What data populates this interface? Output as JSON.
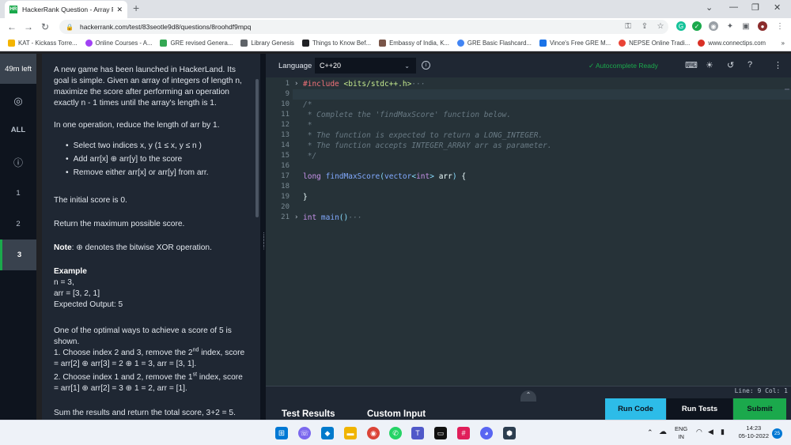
{
  "browser": {
    "tab_title": "HackerRank Question - Array Re...",
    "tab_favicon": "HR",
    "url": "hackerrank.com/test/83seotle9d8/questions/8roohdf9mpq",
    "bookmarks": [
      "KAT - Kickass Torre...",
      "Online Courses - A...",
      "GRE revised Genera...",
      "Library Genesis",
      "Things to Know Bef...",
      "Embassy of India, K...",
      "GRE Basic Flashcard...",
      "Vince's Free GRE M...",
      "NEPSE Online Tradi...",
      "www.connectips.com"
    ],
    "bookmark_colors": [
      "#f4b400",
      "#a142f4",
      "#34a853",
      "#5f6368",
      "#202124",
      "#795548",
      "#4285f4",
      "#1a73e8",
      "#ea4335",
      "#d93025"
    ]
  },
  "sidenav": {
    "timer": "49m left",
    "all_label": "ALL",
    "questions": [
      "1",
      "2",
      "3"
    ]
  },
  "problem": {
    "p1": "A new game has been launched in HackerLand. Its goal is simple. Given an array of integers of length n, maximize the score after performing an operation exactly n - 1 times until the array's length is 1.",
    "p2": "In one operation, reduce the length of arr by 1.",
    "bullets": [
      "Select two indices x, y (1 ≤ x, y ≤ n )",
      "Add arr[x] ⊕ arr[y] to the score",
      "Remove either arr[x] or arr[y] from arr."
    ],
    "p3": "The initial score is 0.",
    "p4": "Return the maximum possible score.",
    "note_label": "Note",
    "note_text": ": ⊕ denotes the bitwise XOR operation.",
    "example_title": "Example",
    "ex_n": "n = 3,",
    "ex_arr": "arr = [3, 2, 1]",
    "ex_out": "Expected Output: 5",
    "p5": "One of the optimal ways to achieve a score of 5 is shown.",
    "step1": "1. Choose index 2 and 3, remove the 2",
    "step1_sup": "nd",
    "step1_rest": " index, score = arr[2] ⊕ arr[3] = 2 ⊕ 1 = 3, arr = [3, 1].",
    "step2": "2. Choose index 1 and 2, remove the 1",
    "step2_sup": "st",
    "step2_rest": " index, score = arr[1] ⊕ arr[2] = 3 ⊕ 1 = 2, arr = [1].",
    "p6": "Sum the results and return the total score, 3+2 = 5."
  },
  "editor": {
    "language_label": "Language",
    "language_value": "C++20",
    "autocomplete": "Autocomplete Ready",
    "line_numbers": [
      "1",
      "9",
      "10",
      "11",
      "12",
      "13",
      "14",
      "15",
      "16",
      "17",
      "18",
      "19",
      "20",
      "21"
    ],
    "status": "Line: 9 Col: 1",
    "test_results": "Test Results",
    "custom_input": "Custom Input",
    "run_code": "Run Code",
    "run_tests": "Run Tests",
    "submit": "Submit"
  },
  "taskbar": {
    "lang": "ENG",
    "region": "IN",
    "time": "14:23",
    "date": "05-10-2022",
    "notif": "25"
  }
}
